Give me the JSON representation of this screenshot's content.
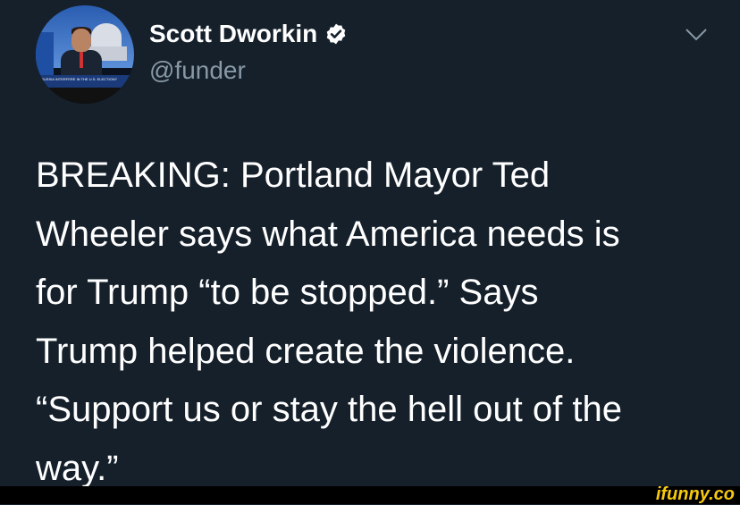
{
  "tweet": {
    "author_name": "Scott Dworkin",
    "handle": "@funder",
    "text": "BREAKING: Portland Mayor Ted\nWheeler says what America needs is\nfor Trump “to be stopped.” Says\nTrump helped create the violence.\n“Support us or stay the hell out of the\nway.”",
    "verified_icon": "verified-badge-icon",
    "menu_icon": "chevron-down-icon",
    "avatar_ticker_text": "RUSSIA INTERFERE IN THE U.S. ELECTION?"
  },
  "watermark": {
    "text": "ifunny.co"
  },
  "colors": {
    "background": "#15202b",
    "text": "#ffffff",
    "secondary_text": "#8899a6",
    "watermark": "#f6c90e"
  }
}
